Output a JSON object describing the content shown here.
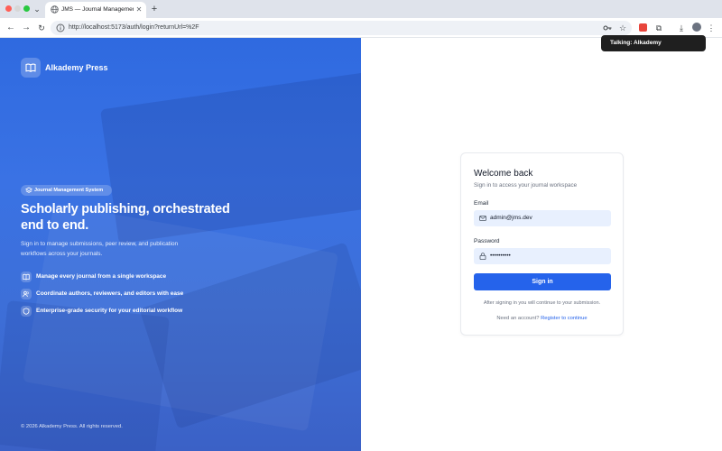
{
  "browser": {
    "tab_title": "JMS — Journal Management",
    "tab_close": "✕",
    "new_tab": "+",
    "chevron": "⌄",
    "url": "http://localhost:5173/auth/login?returnUrl=%2F",
    "back": "←",
    "forward": "→",
    "reload": "↻",
    "star": "☆",
    "puzzle": "⧉",
    "download": "⤓",
    "kebab": "⋮",
    "popup_text": "Talking: Alkademy"
  },
  "hero": {
    "brand_name": "Alkademy Press",
    "badge": "Journal Management System",
    "title": "Scholarly publishing, orchestrated end to end.",
    "subtitle": "Sign in to manage submissions, peer review, and publication workflows across your journals.",
    "features": [
      {
        "icon": "book-icon",
        "text": "Manage every journal from a single workspace"
      },
      {
        "icon": "users-icon",
        "text": "Coordinate authors, reviewers, and editors with ease"
      },
      {
        "icon": "shield-icon",
        "text": "Enterprise-grade security for your editorial workflow"
      }
    ],
    "copyright": "© 2026 Alkademy Press. All rights reserved."
  },
  "login": {
    "title": "Welcome back",
    "subtitle": "Sign in to access your journal workspace",
    "email_label": "Email",
    "email_value": "admin@jms.dev",
    "password_label": "Password",
    "password_value": "••••••••••",
    "submit": "Sign in",
    "after_note": "After signing in you will continue to your submission.",
    "register_prompt": "Need an account?",
    "register_link": "Register to continue"
  },
  "colors": {
    "hero_gradient_top": "#2f6ae0",
    "hero_gradient_bottom": "#3b61c6",
    "primary_button": "#2563eb",
    "input_fill": "#e8f0fe"
  }
}
